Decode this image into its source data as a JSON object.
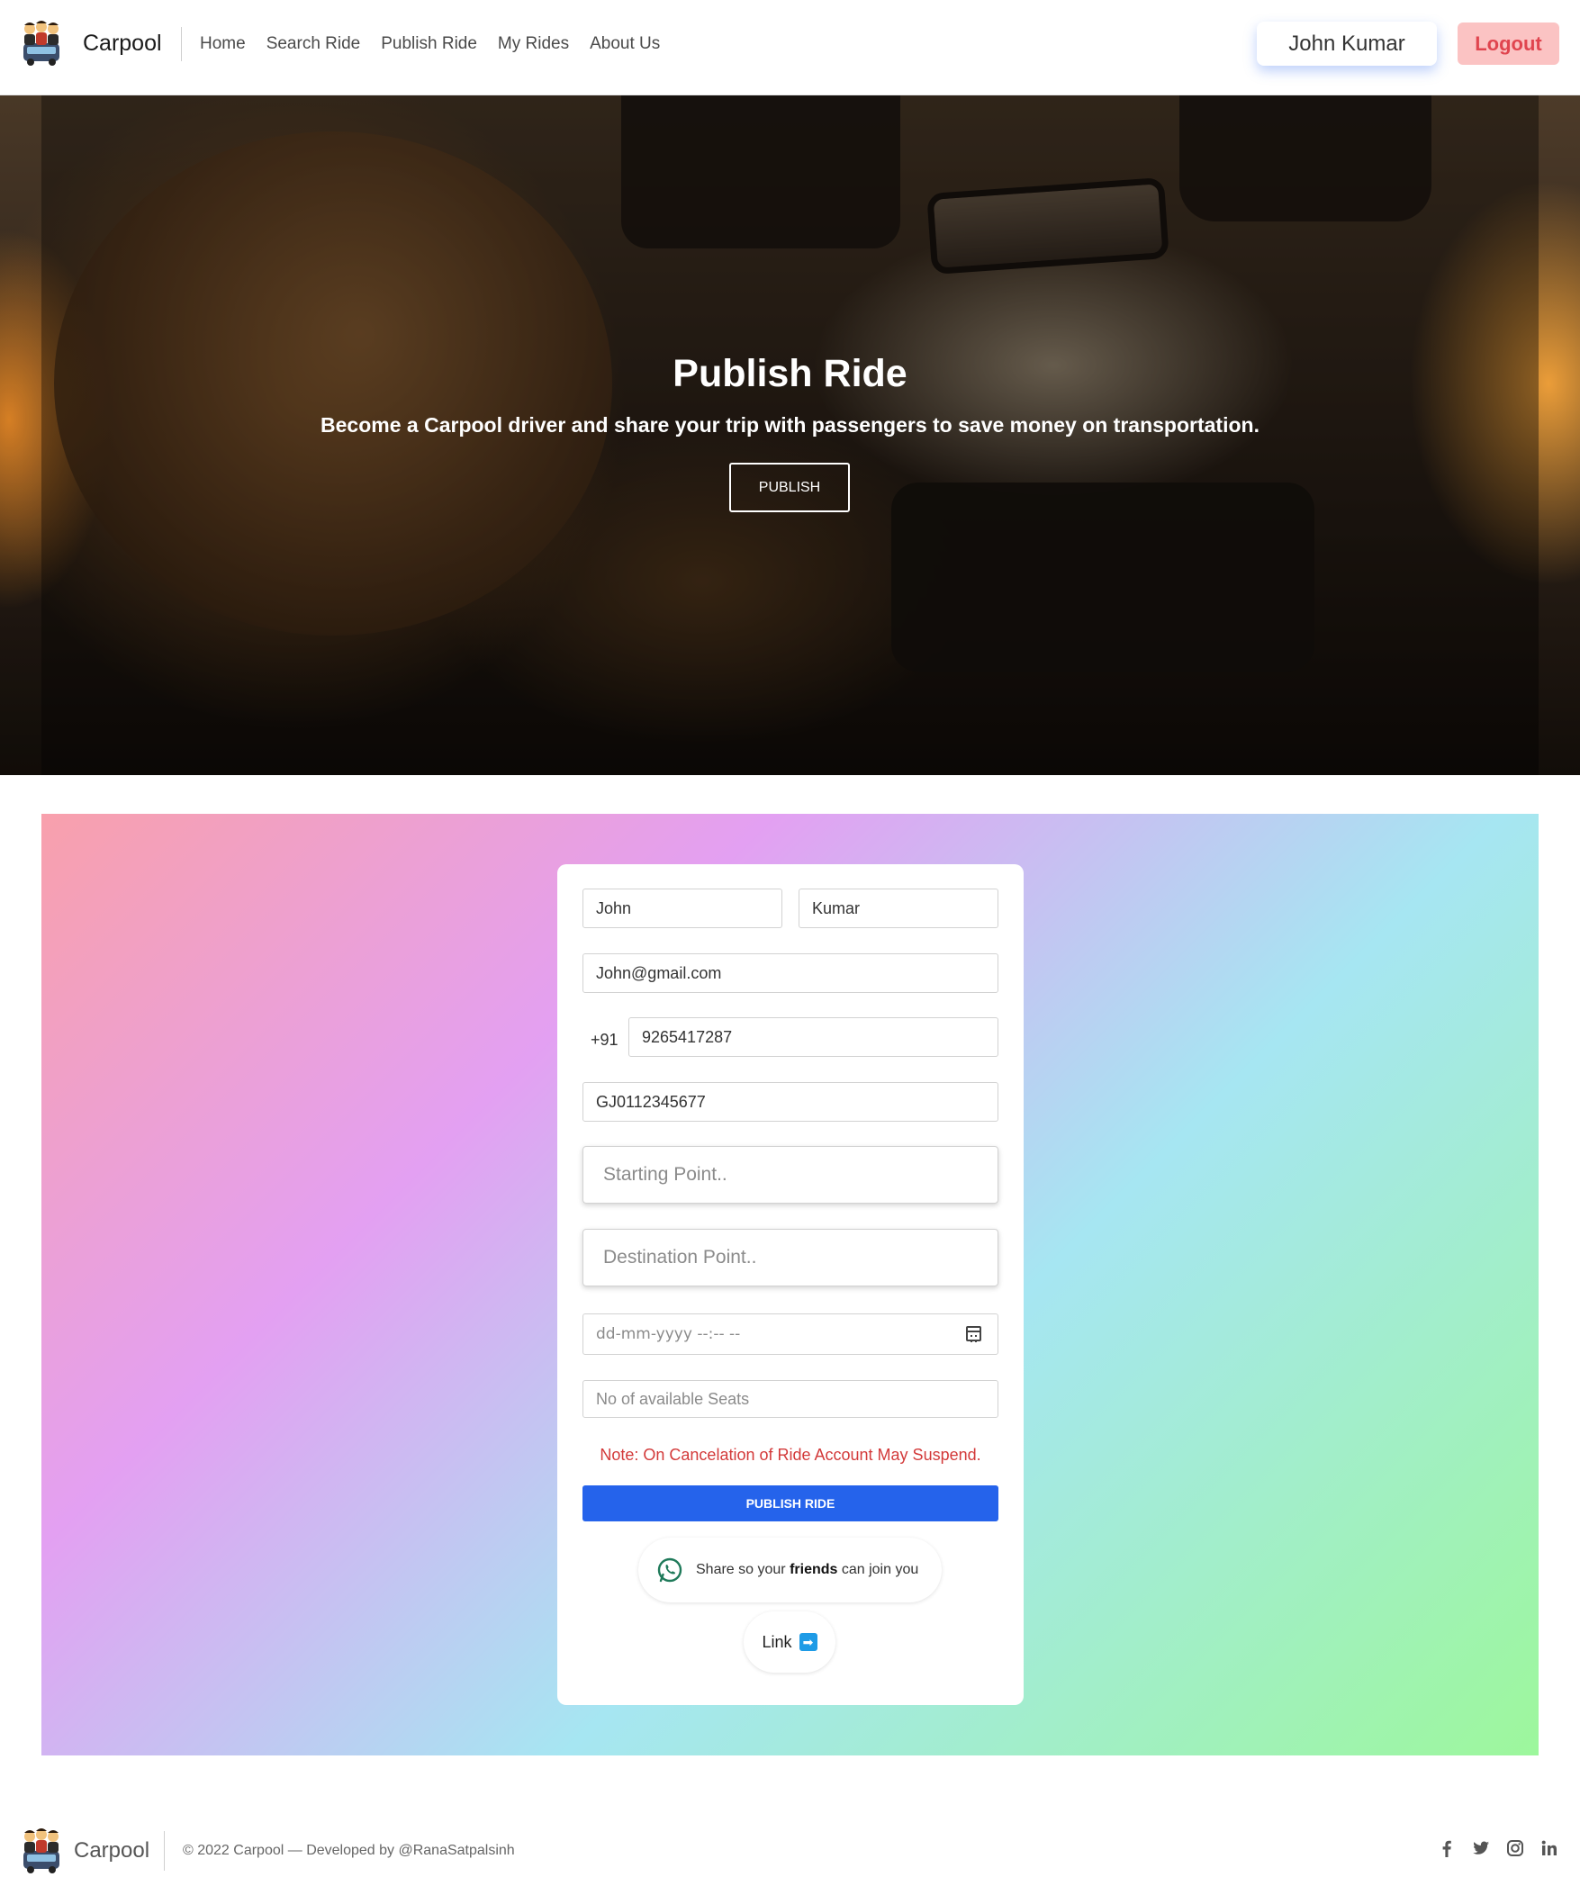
{
  "navbar": {
    "brand": "Carpool",
    "links": [
      "Home",
      "Search Ride",
      "Publish Ride",
      "My Rides",
      "About Us"
    ],
    "user_name": "John Kumar",
    "logout_label": "Logout"
  },
  "hero": {
    "title": "Publish Ride",
    "subtitle": "Become a Carpool driver and share your trip with passengers to save money on transportation.",
    "button_label": "PUBLISH"
  },
  "form": {
    "first_name": "John",
    "last_name": "Kumar",
    "email": "John@gmail.com",
    "phone_prefix": "+91",
    "phone": "9265417287",
    "vehicle_number": "GJ0112345677",
    "starting_point_placeholder": "Starting Point..",
    "destination_placeholder": "Destination Point..",
    "datetime_placeholder": "dd-mm-yyyy --:-- --",
    "seats_placeholder": "No of available Seats",
    "note": "Note: On Cancelation of Ride Account May Suspend.",
    "submit_label": "PUBLISH RIDE",
    "share_prefix": "Share so your ",
    "share_bold": "friends",
    "share_suffix": " can join you",
    "link_label": "Link",
    "link_arrow": "➡"
  },
  "footer": {
    "brand": "Carpool",
    "copyright": "© 2022 Carpool —  Developed by @RanaSatpalsinh",
    "socials": [
      "facebook-icon",
      "twitter-icon",
      "instagram-icon",
      "linkedin-icon"
    ]
  },
  "colors": {
    "primary_button": "#2563eb",
    "logout_bg": "#fbc3c3",
    "logout_text": "#e0454f",
    "note_text": "#d33a3a"
  }
}
